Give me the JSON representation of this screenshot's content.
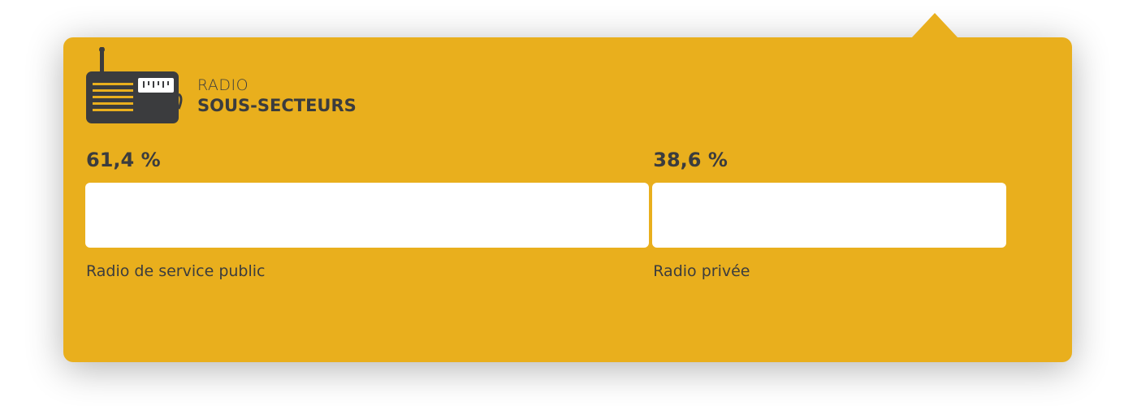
{
  "card": {
    "color": "#e9af1d",
    "category": "RADIO",
    "title": "SOUS-SECTEURS",
    "icon": "radio-icon"
  },
  "chart_data": {
    "type": "bar",
    "orientation": "horizontal-stacked",
    "categories": [
      "Radio de service public",
      "Radio privée"
    ],
    "values": [
      61.4,
      38.6
    ],
    "value_labels": [
      "61,4 %",
      "38,6 %"
    ],
    "unit": "%",
    "bar_color": "#ffffff"
  }
}
